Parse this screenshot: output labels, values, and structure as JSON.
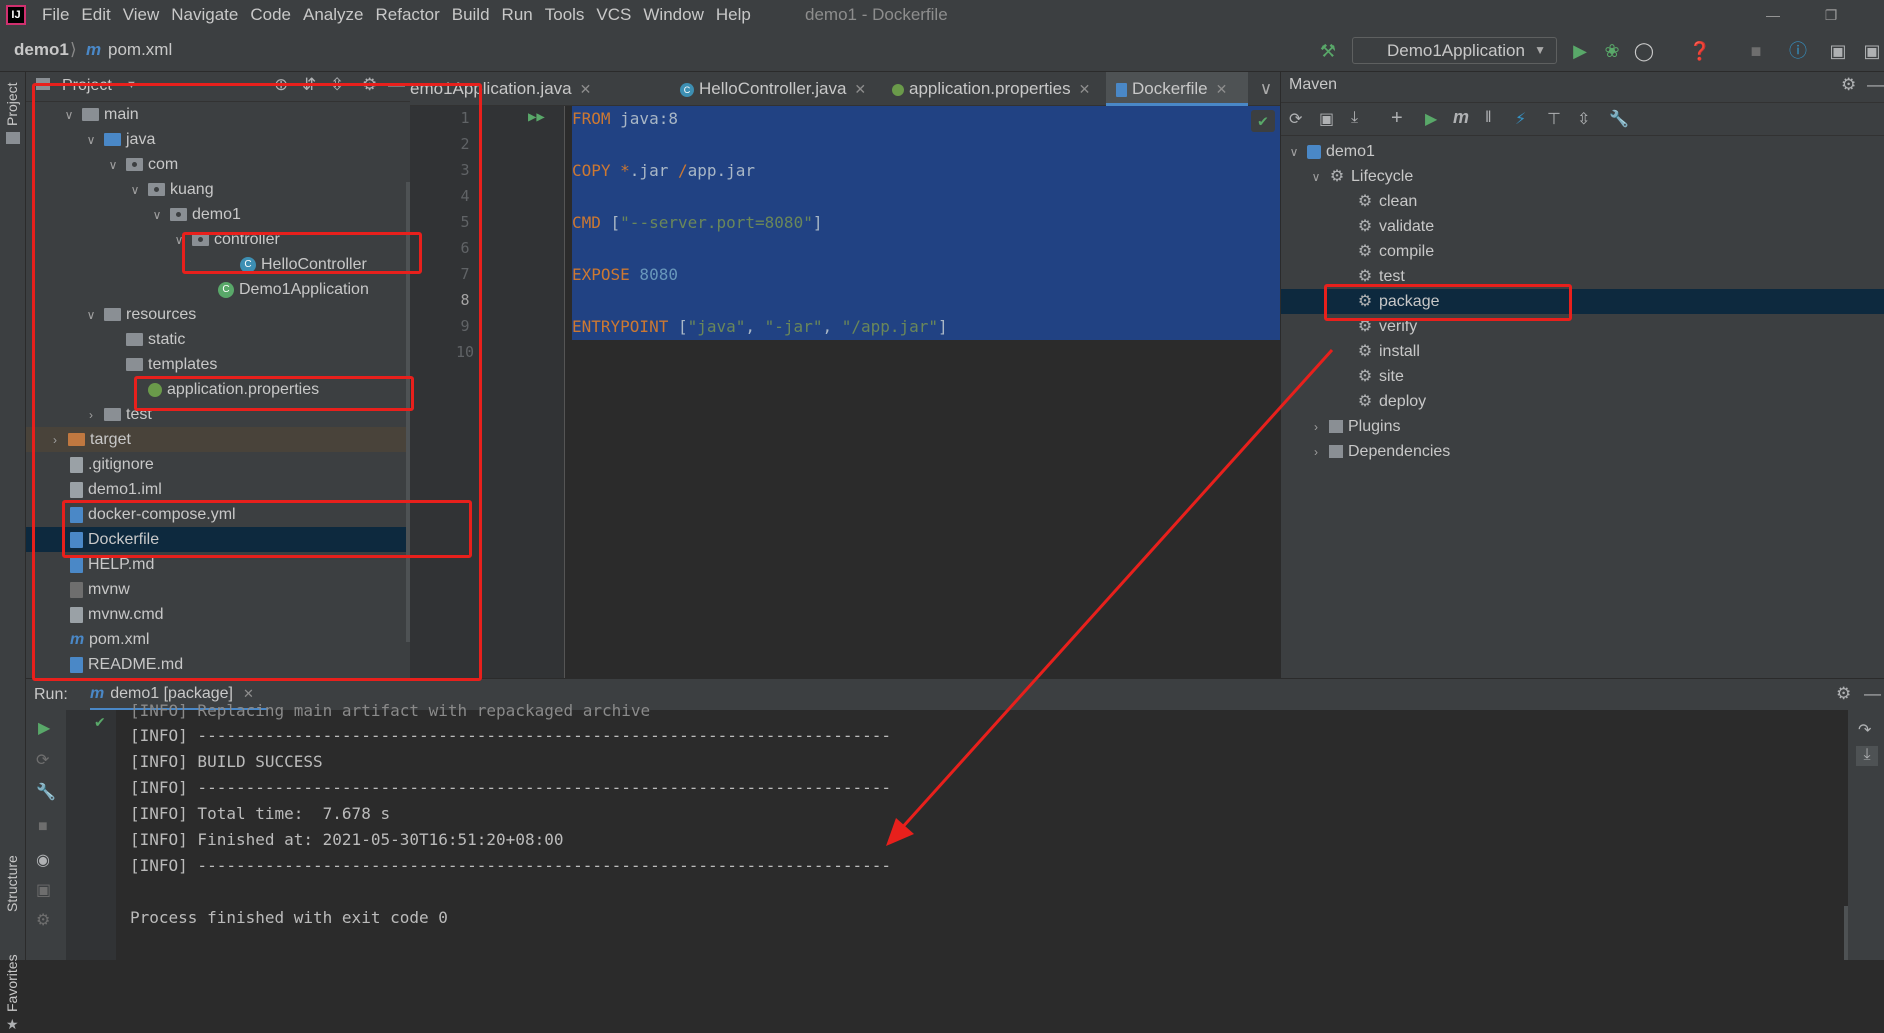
{
  "menubar": {
    "items": [
      "File",
      "Edit",
      "View",
      "Navigate",
      "Code",
      "Analyze",
      "Refactor",
      "Build",
      "Run",
      "Tools",
      "VCS",
      "Window",
      "Help"
    ],
    "window_title": "demo1 - Dockerfile"
  },
  "navbar": {
    "project": "demo1",
    "file": "pom.xml",
    "run_config": "Demo1Application"
  },
  "left_strip": {
    "project": "Project",
    "structure": "Structure",
    "favorites": "Favorites"
  },
  "project_panel": {
    "title": "Project",
    "tree": [
      {
        "label": "main",
        "type": "folder"
      },
      {
        "label": "java",
        "type": "folder"
      },
      {
        "label": "com",
        "type": "package"
      },
      {
        "label": "kuang",
        "type": "package"
      },
      {
        "label": "demo1",
        "type": "package"
      },
      {
        "label": "controller",
        "type": "package"
      },
      {
        "label": "HelloController",
        "type": "class"
      },
      {
        "label": "Demo1Application",
        "type": "class"
      },
      {
        "label": "resources",
        "type": "folder"
      },
      {
        "label": "static",
        "type": "folder"
      },
      {
        "label": "templates",
        "type": "folder"
      },
      {
        "label": "application.properties",
        "type": "properties"
      },
      {
        "label": "test",
        "type": "folder"
      },
      {
        "label": "target",
        "type": "folder"
      },
      {
        "label": ".gitignore",
        "type": "file"
      },
      {
        "label": "demo1.iml",
        "type": "file"
      },
      {
        "label": "docker-compose.yml",
        "type": "file"
      },
      {
        "label": "Dockerfile",
        "type": "file"
      },
      {
        "label": "HELP.md",
        "type": "file"
      },
      {
        "label": "mvnw",
        "type": "file"
      },
      {
        "label": "mvnw.cmd",
        "type": "file"
      },
      {
        "label": "pom.xml",
        "type": "maven"
      },
      {
        "label": "README.md",
        "type": "file"
      }
    ]
  },
  "editor": {
    "tabs": [
      "emo1Application.java",
      "HelloController.java",
      "application.properties",
      "Dockerfile"
    ],
    "active_tab": "Dockerfile",
    "line_numbers": [
      "1",
      "2",
      "3",
      "4",
      "5",
      "6",
      "7",
      "8",
      "9",
      "10"
    ],
    "code": {
      "l1_kw": "FROM",
      "l1_rest": " java:8",
      "l3_kw": "COPY",
      "l3_star": " *",
      "l3_rest": ".jar ",
      "l3_slash": "/",
      "l3_tail": "app.jar",
      "l5_kw": "CMD",
      "l5_b1": " [",
      "l5_str": "\"--server.port=8080\"",
      "l5_b2": "]",
      "l7_kw": "EXPOSE",
      "l7_num": " 8080",
      "l9_kw": "ENTRYPOINT",
      "l9_b1": " [",
      "l9_s1": "\"java\"",
      "l9_c1": ", ",
      "l9_s2": "\"-jar\"",
      "l9_c2": ", ",
      "l9_s3": "\"/app.jar\"",
      "l9_b2": "]"
    }
  },
  "maven": {
    "title": "Maven",
    "project": "demo1",
    "lifecycle": "Lifecycle",
    "goals": [
      "clean",
      "validate",
      "compile",
      "test",
      "package",
      "verify",
      "install",
      "site",
      "deploy"
    ],
    "selected_goal": "package",
    "plugins": "Plugins",
    "dependencies": "Dependencies"
  },
  "run_panel": {
    "label": "Run:",
    "tab": "demo1 [package]",
    "console": [
      "[INFO] Replacing main artifact with repackaged archive",
      "[INFO] ------------------------------------------------------------------------",
      "[INFO] BUILD SUCCESS",
      "[INFO] ------------------------------------------------------------------------",
      "[INFO] Total time:  7.678 s",
      "[INFO] Finished at: 2021-05-30T16:51:20+08:00",
      "[INFO] ------------------------------------------------------------------------",
      "",
      "Process finished with exit code 0"
    ]
  },
  "colors": {
    "annotation_red": "#e8201c",
    "selection_blue": "#214283",
    "accent": "#4a88c7"
  }
}
